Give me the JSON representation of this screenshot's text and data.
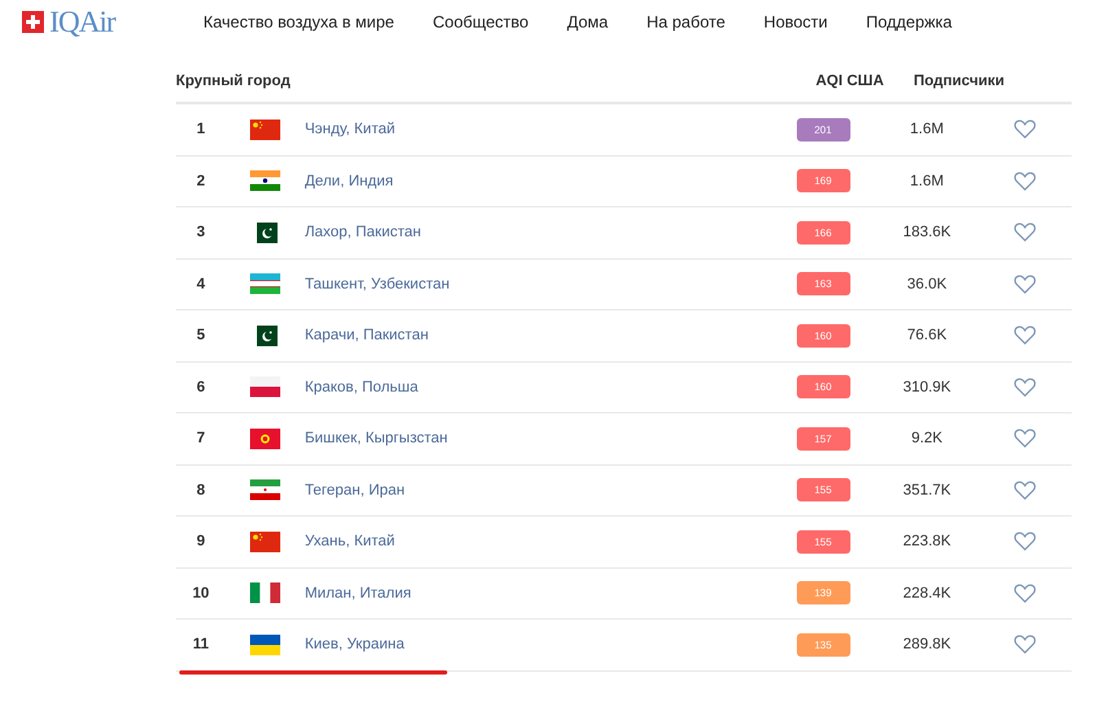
{
  "logo": {
    "text": "IQAir"
  },
  "nav": [
    "Качество воздуха в мире",
    "Сообщество",
    "Дома",
    "На работе",
    "Новости",
    "Поддержка"
  ],
  "table": {
    "columns": [
      "Крупный город",
      "AQI США",
      "Подписчики"
    ],
    "rows": [
      {
        "rank": "1",
        "kind": "cn",
        "city": "Чэнду, Китай",
        "aqi": "201",
        "color": "#a87bbd",
        "subscribers": "1.6M",
        "underlined": false
      },
      {
        "rank": "2",
        "kind": "in",
        "city": "Дели, Индия",
        "aqi": "169",
        "color": "#fe6a69",
        "subscribers": "1.6M",
        "underlined": false
      },
      {
        "rank": "3",
        "kind": "pk",
        "city": "Лахор, Пакистан",
        "aqi": "166",
        "color": "#fe6a69",
        "subscribers": "183.6K",
        "underlined": false
      },
      {
        "rank": "4",
        "kind": "uz",
        "city": "Ташкент, Узбекистан",
        "aqi": "163",
        "color": "#fe6a69",
        "subscribers": "36.0K",
        "underlined": false
      },
      {
        "rank": "5",
        "kind": "pk",
        "city": "Карачи, Пакистан",
        "aqi": "160",
        "color": "#fe6a69",
        "subscribers": "76.6K",
        "underlined": false
      },
      {
        "rank": "6",
        "kind": "pl",
        "city": "Краков, Польша",
        "aqi": "160",
        "color": "#fe6a69",
        "subscribers": "310.9K",
        "underlined": false
      },
      {
        "rank": "7",
        "kind": "kg",
        "city": "Бишкек, Кыргызстан",
        "aqi": "157",
        "color": "#fe6a69",
        "subscribers": "9.2K",
        "underlined": false
      },
      {
        "rank": "8",
        "kind": "ir",
        "city": "Тегеран, Иран",
        "aqi": "155",
        "color": "#fe6a69",
        "subscribers": "351.7K",
        "underlined": false
      },
      {
        "rank": "9",
        "kind": "cn",
        "city": "Ухань, Китай",
        "aqi": "155",
        "color": "#fe6a69",
        "subscribers": "223.8K",
        "underlined": false
      },
      {
        "rank": "10",
        "kind": "it",
        "city": "Милан, Италия",
        "aqi": "139",
        "color": "#fe9b57",
        "subscribers": "228.4K",
        "underlined": false
      },
      {
        "rank": "11",
        "kind": "ua",
        "city": "Киев, Украина",
        "aqi": "135",
        "color": "#fe9b57",
        "subscribers": "289.8K",
        "underlined": true
      }
    ]
  }
}
